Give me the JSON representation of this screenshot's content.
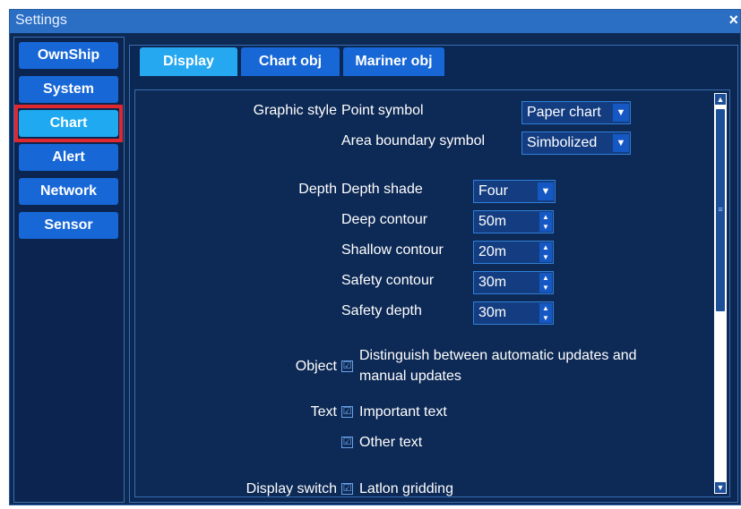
{
  "window": {
    "title": "Settings",
    "close_label": "×"
  },
  "nav": {
    "items": [
      {
        "label": "OwnShip"
      },
      {
        "label": "System"
      },
      {
        "label": "Chart"
      },
      {
        "label": "Alert"
      },
      {
        "label": "Network"
      },
      {
        "label": "Sensor"
      }
    ],
    "selected": "Chart"
  },
  "tabs": [
    {
      "label": "Display"
    },
    {
      "label": "Chart obj"
    },
    {
      "label": "Mariner obj"
    }
  ],
  "active_tab": "Display",
  "graphic_style": {
    "section_label": "Graphic style",
    "point_symbol": {
      "label": "Point symbol",
      "value": "Paper chart"
    },
    "area_boundary_symbol": {
      "label": "Area boundary symbol",
      "value": "Simbolized"
    }
  },
  "depth": {
    "section_label": "Depth",
    "depth_shade": {
      "label": "Depth shade",
      "value": "Four"
    },
    "deep_contour": {
      "label": "Deep contour",
      "value": "50m"
    },
    "shallow_contour": {
      "label": "Shallow contour",
      "value": "20m"
    },
    "safety_contour": {
      "label": "Safety contour",
      "value": "30m"
    },
    "safety_depth": {
      "label": "Safety depth",
      "value": "30m"
    }
  },
  "object": {
    "section_label": "Object",
    "distinguish_updates": {
      "label_line1": "Distinguish between automatic updates and",
      "label_line2": "manual updates",
      "checked": true
    }
  },
  "text": {
    "section_label": "Text",
    "important_text": {
      "label": "Important text",
      "checked": true
    },
    "other_text": {
      "label": "Other text",
      "checked": true
    }
  },
  "display_switch": {
    "section_label": "Display switch",
    "latlon_gridding": {
      "label": "Latlon gridding",
      "checked": true
    }
  },
  "glyphs": {
    "dropdown_arrow": "▼",
    "spin_up": "▲",
    "spin_down": "▼",
    "check": "☑",
    "grip": "≡"
  },
  "colors": {
    "accent": "#1767d6",
    "selected": "#1fa9f0",
    "highlight": "#e0282f",
    "background": "#0d2a55"
  }
}
